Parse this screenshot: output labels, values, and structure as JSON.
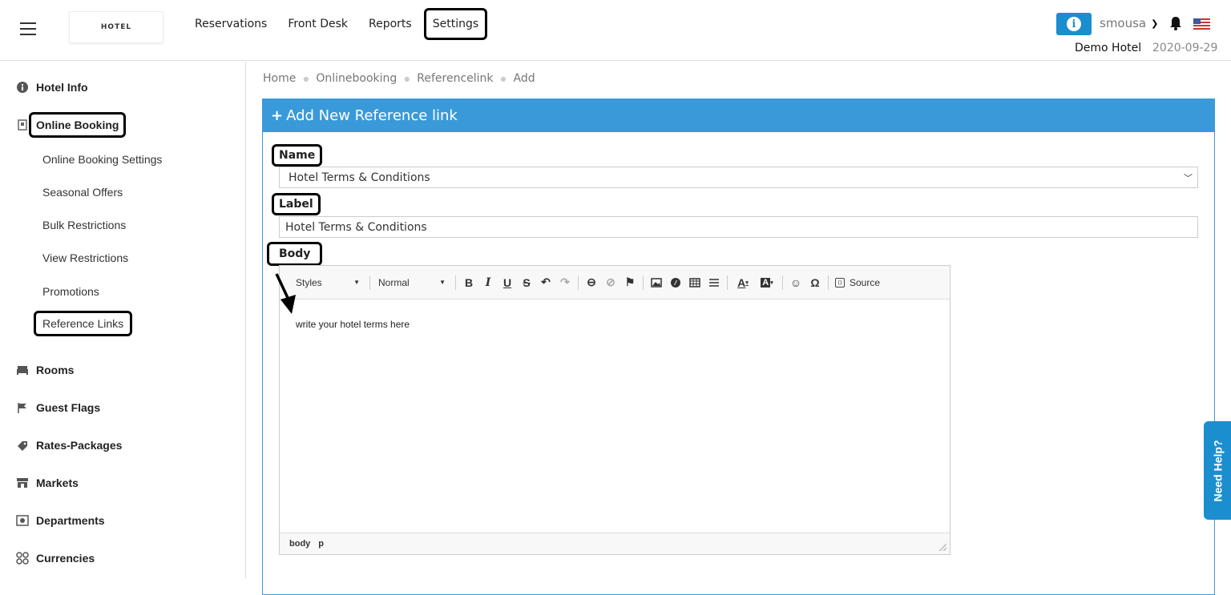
{
  "header": {
    "logo_text": "HOTEL",
    "nav": [
      "Reservations",
      "Front Desk",
      "Reports",
      "Settings"
    ],
    "user": "smousa",
    "hotel_name": "Demo Hotel",
    "date": "2020-09-29"
  },
  "sidebar": {
    "hotel_info": "Hotel Info",
    "online_booking": "Online Booking",
    "sub": [
      "Online Booking Settings",
      "Seasonal Offers",
      "Bulk Restrictions",
      "View Restrictions",
      "Promotions",
      "Reference Links"
    ],
    "items": [
      "Rooms",
      "Guest Flags",
      "Rates-Packages",
      "Markets",
      "Departments",
      "Currencies"
    ]
  },
  "breadcrumb": [
    "Home",
    "Onlinebooking",
    "Referencelink",
    "Add"
  ],
  "panel": {
    "title": "Add New Reference link",
    "name_label": "Name",
    "name_value": "Hotel Terms & Conditions",
    "label_label": "Label",
    "label_value": "Hotel Terms & Conditions",
    "body_label": "Body"
  },
  "editor": {
    "styles": "Styles",
    "format": "Normal",
    "source": "Source",
    "content": "write your hotel terms here",
    "path": [
      "body",
      "p"
    ]
  },
  "help": "Need Help?",
  "colors": {
    "accent": "#3a9ad9",
    "help": "#1b8ecf"
  }
}
